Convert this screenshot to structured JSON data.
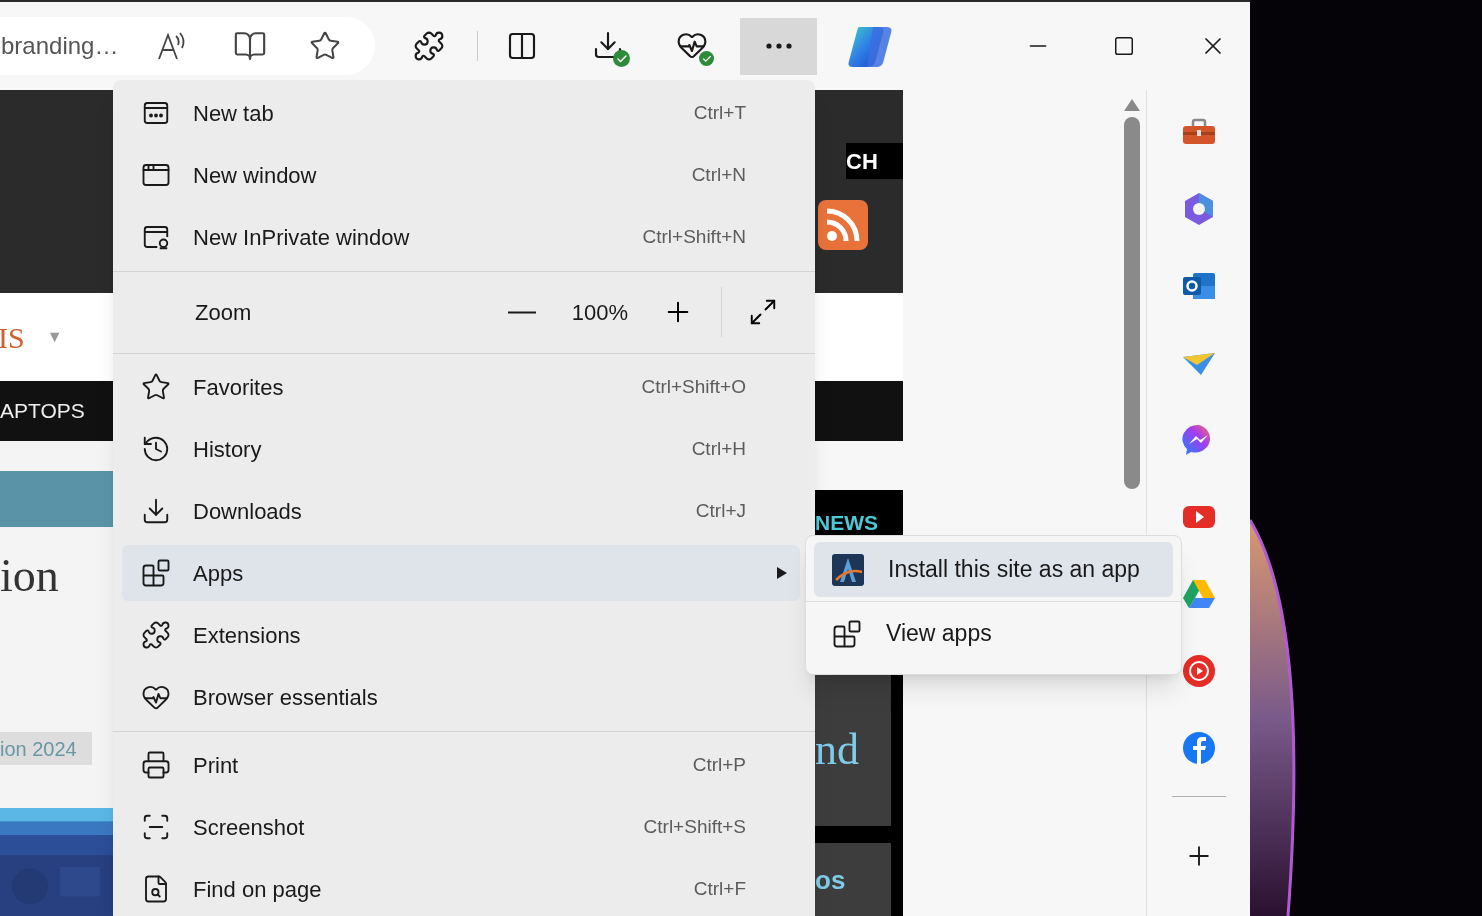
{
  "toolbar": {
    "address": "branding…",
    "menu_button_selected": true
  },
  "page": {
    "left": {
      "menu_text": "IS",
      "caret": "▼",
      "nav_item": "APTOPS",
      "heading": "ion",
      "tag": "ion 2024"
    },
    "right": {
      "label": "CH",
      "section": "NEWS",
      "heading": "nd",
      "subheading": "os"
    }
  },
  "menu": {
    "items": [
      {
        "kind": "item",
        "label": "New tab",
        "shortcut": "Ctrl+T",
        "selected": false
      },
      {
        "kind": "item",
        "label": "New window",
        "shortcut": "Ctrl+N",
        "selected": false
      },
      {
        "kind": "item",
        "label": "New InPrivate window",
        "shortcut": "Ctrl+Shift+N",
        "selected": false
      },
      {
        "kind": "divider"
      },
      {
        "kind": "zoom",
        "label": "Zoom",
        "value": "100%"
      },
      {
        "kind": "divider"
      },
      {
        "kind": "item",
        "label": "Favorites",
        "shortcut": "Ctrl+Shift+O",
        "selected": false
      },
      {
        "kind": "item",
        "label": "History",
        "shortcut": "Ctrl+H",
        "selected": false
      },
      {
        "kind": "item",
        "label": "Downloads",
        "shortcut": "Ctrl+J",
        "selected": false
      },
      {
        "kind": "item",
        "label": "Apps",
        "has_submenu": true,
        "selected": true
      },
      {
        "kind": "item",
        "label": "Extensions",
        "selected": false
      },
      {
        "kind": "item",
        "label": "Browser essentials",
        "selected": false
      },
      {
        "kind": "divider"
      },
      {
        "kind": "item",
        "label": "Print",
        "shortcut": "Ctrl+P",
        "selected": false
      },
      {
        "kind": "item",
        "label": "Screenshot",
        "shortcut": "Ctrl+Shift+S",
        "selected": false
      },
      {
        "kind": "item",
        "label": "Find on page",
        "shortcut": "Ctrl+F",
        "selected": false
      }
    ]
  },
  "submenu": {
    "items": [
      {
        "label": "Install this site as an app",
        "selected": true
      },
      {
        "label": "View apps",
        "selected": false
      }
    ]
  }
}
